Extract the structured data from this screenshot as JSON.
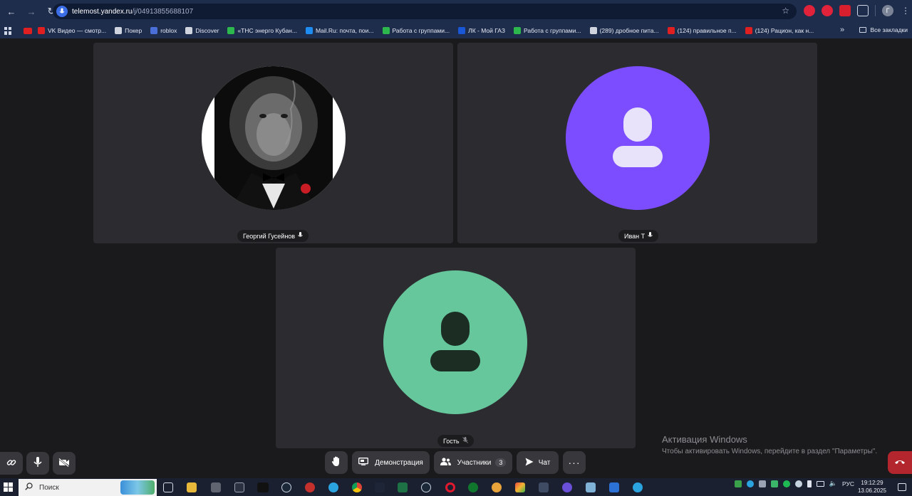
{
  "browser": {
    "url_host": "telemost.yandex.ru",
    "url_path": "/j/04913855688107",
    "bookmarks": [
      {
        "label": "VK Видео — смотр...",
        "color": "#e02020"
      },
      {
        "label": "Покер",
        "color": "#cfd4de"
      },
      {
        "label": "roblox",
        "color": "#4a6fd8"
      },
      {
        "label": "Discover",
        "color": "#cfd4de"
      },
      {
        "label": "«ТНС энерго Кубан...",
        "color": "#2db84d"
      },
      {
        "label": "Mail.Ru: почта, пои...",
        "color": "#1e8cf0"
      },
      {
        "label": "Работа с группами...",
        "color": "#2db84d"
      },
      {
        "label": "ЛК - Мой ГАЗ",
        "color": "#1a57d6"
      },
      {
        "label": "Работа с группами...",
        "color": "#2db84d"
      },
      {
        "label": "(289) дробное пита...",
        "color": "#cfd4de"
      },
      {
        "label": "(124) правильное п...",
        "color": "#e02020"
      },
      {
        "label": "(124) Рацион, как н...",
        "color": "#e02020"
      }
    ],
    "all_bookmarks": "Все закладки",
    "profile_initial": "Г"
  },
  "participants": [
    {
      "name": "Георгий Гусейнов",
      "avatar": "lion-photo",
      "mic": "on"
    },
    {
      "name": "Иван Т",
      "avatar": "person-icon",
      "color": "#7c4dff",
      "mic": "on"
    },
    {
      "name": "Гость",
      "avatar": "person-icon",
      "color": "#66c79c",
      "mic": "off"
    }
  ],
  "controls": {
    "demo_label": "Демонстрация",
    "participants_label": "Участники",
    "participants_count": "3",
    "chat_label": "Чат"
  },
  "activation": {
    "title": "Активация Windows",
    "subtitle": "Чтобы активировать Windows, перейдите в раздел \"Параметры\"."
  },
  "taskbar": {
    "search_placeholder": "Поиск",
    "language": "РУС",
    "time": "19:12:29",
    "date": "13.06.2025"
  }
}
